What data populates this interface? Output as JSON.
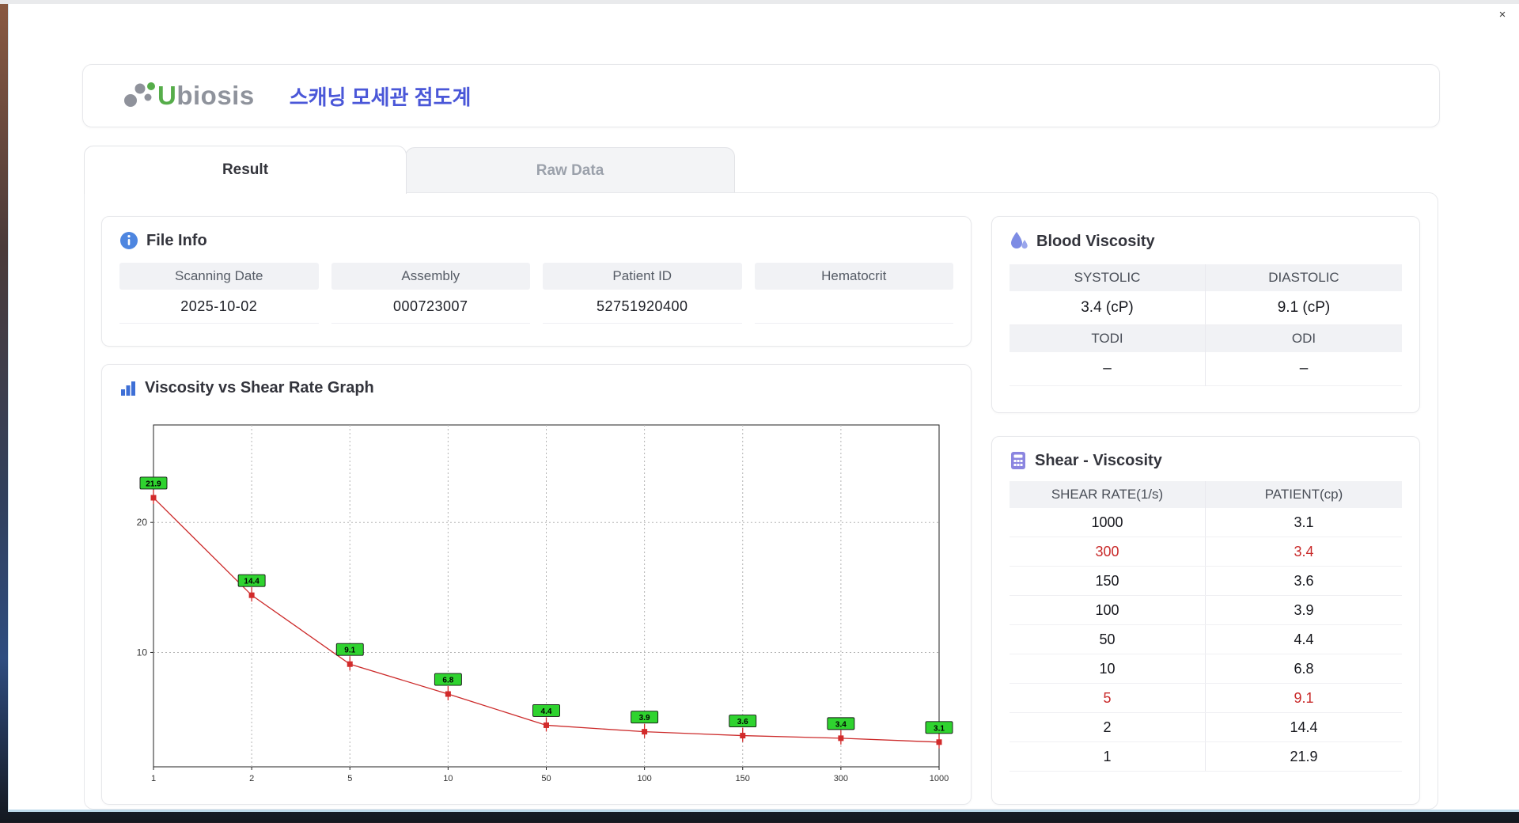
{
  "window": {
    "close_label": "×"
  },
  "header": {
    "logo_u": "U",
    "logo_rest": "biosis",
    "title": "스캐닝 모세관 점도계"
  },
  "tabs": [
    {
      "label": "Result"
    },
    {
      "label": "Raw Data"
    }
  ],
  "file_info": {
    "title": "File Info",
    "fields": [
      {
        "label": "Scanning Date",
        "value": "2025-10-02"
      },
      {
        "label": "Assembly",
        "value": "000723007"
      },
      {
        "label": "Patient ID",
        "value": "52751920400"
      },
      {
        "label": "Hematocrit",
        "value": ""
      }
    ]
  },
  "graph_card": {
    "title": "Viscosity vs Shear Rate Graph"
  },
  "chart_data": {
    "type": "line",
    "x_categories": [
      "1",
      "2",
      "5",
      "10",
      "50",
      "100",
      "150",
      "300",
      "1000"
    ],
    "values": [
      21.9,
      14.4,
      9.1,
      6.8,
      4.4,
      3.9,
      3.6,
      3.4,
      3.1
    ],
    "point_labels": [
      "21.9",
      "14.4",
      "9.1",
      "6.8",
      "4.4",
      "3.9",
      "3.6",
      "3.4",
      "3.1"
    ],
    "title": "Viscosity vs Shear Rate Graph",
    "y_ticks": [
      10,
      20
    ],
    "ylim": [
      1.2,
      27.5
    ],
    "grid": true,
    "line_color": "#cc2a2a",
    "marker_color": "#d22b2b",
    "label_bg": "#2fd32f"
  },
  "blood_viscosity": {
    "title": "Blood Viscosity",
    "sections": [
      {
        "headers": [
          "SYSTOLIC",
          "DIASTOLIC"
        ],
        "values": [
          "3.4 (cP)",
          "9.1 (cP)"
        ]
      },
      {
        "headers": [
          "TODI",
          "ODI"
        ],
        "values": [
          "–",
          "–"
        ]
      }
    ]
  },
  "shear_viscosity": {
    "title": "Shear - Viscosity",
    "columns": [
      "SHEAR RATE(1/s)",
      "PATIENT(cp)"
    ],
    "rows": [
      {
        "shear": "1000",
        "patient": "3.1",
        "highlight": false
      },
      {
        "shear": "300",
        "patient": "3.4",
        "highlight": true
      },
      {
        "shear": "150",
        "patient": "3.6",
        "highlight": false
      },
      {
        "shear": "100",
        "patient": "3.9",
        "highlight": false
      },
      {
        "shear": "50",
        "patient": "4.4",
        "highlight": false
      },
      {
        "shear": "10",
        "patient": "6.8",
        "highlight": false
      },
      {
        "shear": "5",
        "patient": "9.1",
        "highlight": true
      },
      {
        "shear": "2",
        "patient": "14.4",
        "highlight": false
      },
      {
        "shear": "1",
        "patient": "21.9",
        "highlight": false
      }
    ]
  }
}
